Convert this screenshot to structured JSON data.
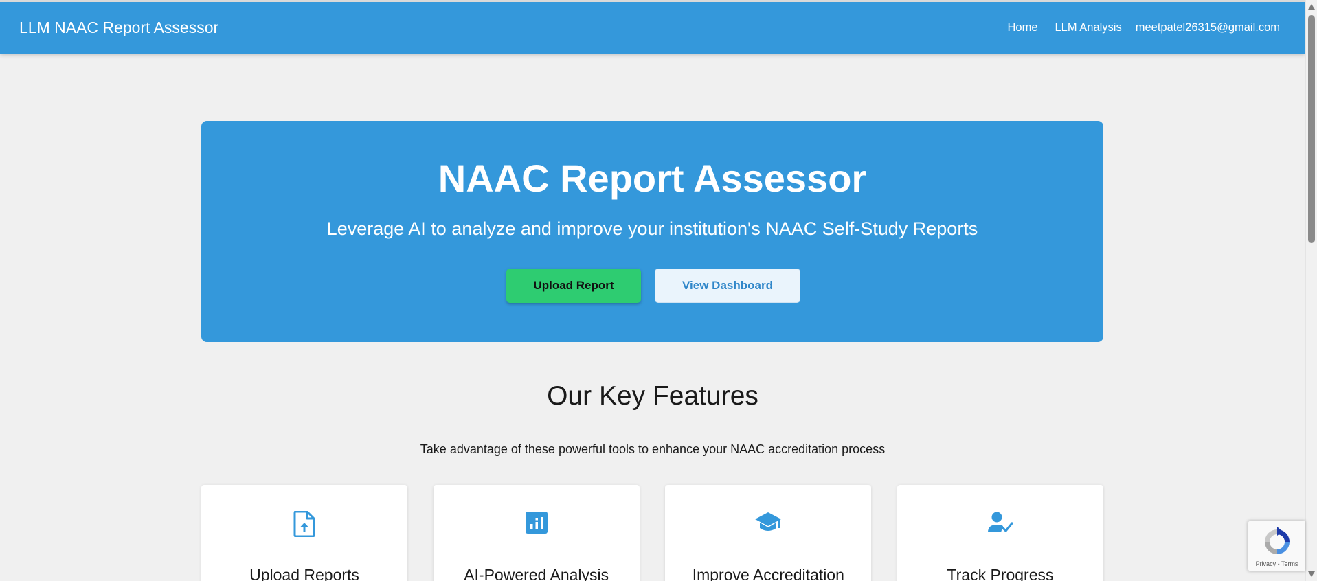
{
  "navbar": {
    "brand": "LLM NAAC Report Assessor",
    "links": [
      {
        "label": "Home"
      },
      {
        "label": "LLM Analysis"
      },
      {
        "label": "meetpatel26315@gmail.com"
      }
    ]
  },
  "hero": {
    "title": "NAAC Report Assessor",
    "subtitle": "Leverage AI to analyze and improve your institution's NAAC Self-Study Reports",
    "upload_button": "Upload Report",
    "dashboard_button": "View Dashboard"
  },
  "features": {
    "title": "Our Key Features",
    "subtitle": "Take advantage of these powerful tools to enhance your NAAC accreditation process",
    "cards": [
      {
        "icon": "upload-file-icon",
        "title": "Upload Reports"
      },
      {
        "icon": "analytics-icon",
        "title": "AI-Powered Analysis"
      },
      {
        "icon": "graduation-cap-icon",
        "title": "Improve Accreditation"
      },
      {
        "icon": "person-check-icon",
        "title": "Track Progress"
      }
    ]
  },
  "recaptcha": {
    "privacy": "Privacy",
    "separator": "-",
    "terms": "Terms"
  },
  "colors": {
    "primary": "#3498db",
    "success": "#2ecc71",
    "background": "#f0f0f0"
  }
}
